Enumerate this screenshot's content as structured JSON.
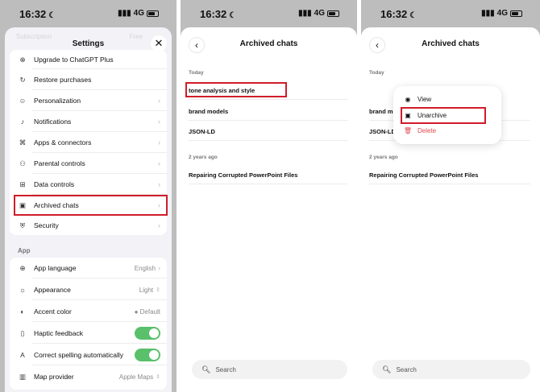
{
  "status": {
    "time": "16:32",
    "network": "4G"
  },
  "settings": {
    "title": "Settings",
    "ghost_left": "Subscription",
    "ghost_right": "Free",
    "account_items": [
      {
        "label": "Upgrade to ChatGPT Plus",
        "icon": "plus-circle-icon"
      },
      {
        "label": "Restore purchases",
        "icon": "restore-icon"
      },
      {
        "label": "Personalization",
        "icon": "person-icon"
      },
      {
        "label": "Notifications",
        "icon": "bell-icon"
      },
      {
        "label": "Apps & connectors",
        "icon": "apps-icon"
      },
      {
        "label": "Parental controls",
        "icon": "family-icon"
      },
      {
        "label": "Data controls",
        "icon": "data-icon"
      },
      {
        "label": "Archived chats",
        "icon": "archive-icon"
      },
      {
        "label": "Security",
        "icon": "shield-icon"
      }
    ],
    "app_section_label": "App",
    "app_items": [
      {
        "label": "App language",
        "value": "English",
        "icon": "globe-icon"
      },
      {
        "label": "Appearance",
        "value": "Light",
        "icon": "sun-icon"
      },
      {
        "label": "Accent color",
        "value": "Default",
        "icon": "palette-icon"
      },
      {
        "label": "Haptic feedback",
        "toggle": true,
        "icon": "haptic-icon"
      },
      {
        "label": "Correct spelling automatically",
        "toggle": true,
        "icon": "spellcheck-icon"
      },
      {
        "label": "Map provider",
        "value": "Apple Maps",
        "icon": "map-icon"
      }
    ]
  },
  "archived": {
    "title": "Archived chats",
    "groups": [
      {
        "label": "Today",
        "chats": [
          "tone analysis and style",
          "brand models",
          "JSON-LD"
        ]
      },
      {
        "label": "2 years ago",
        "chats": [
          "Repairing Corrupted PowerPoint Files"
        ]
      }
    ],
    "search_placeholder": "Search"
  },
  "context_menu": {
    "view": "View",
    "unarchive": "Unarchive",
    "delete": "Delete",
    "delete_color": "#e5484d"
  },
  "highlight_color": "#d11b2a"
}
